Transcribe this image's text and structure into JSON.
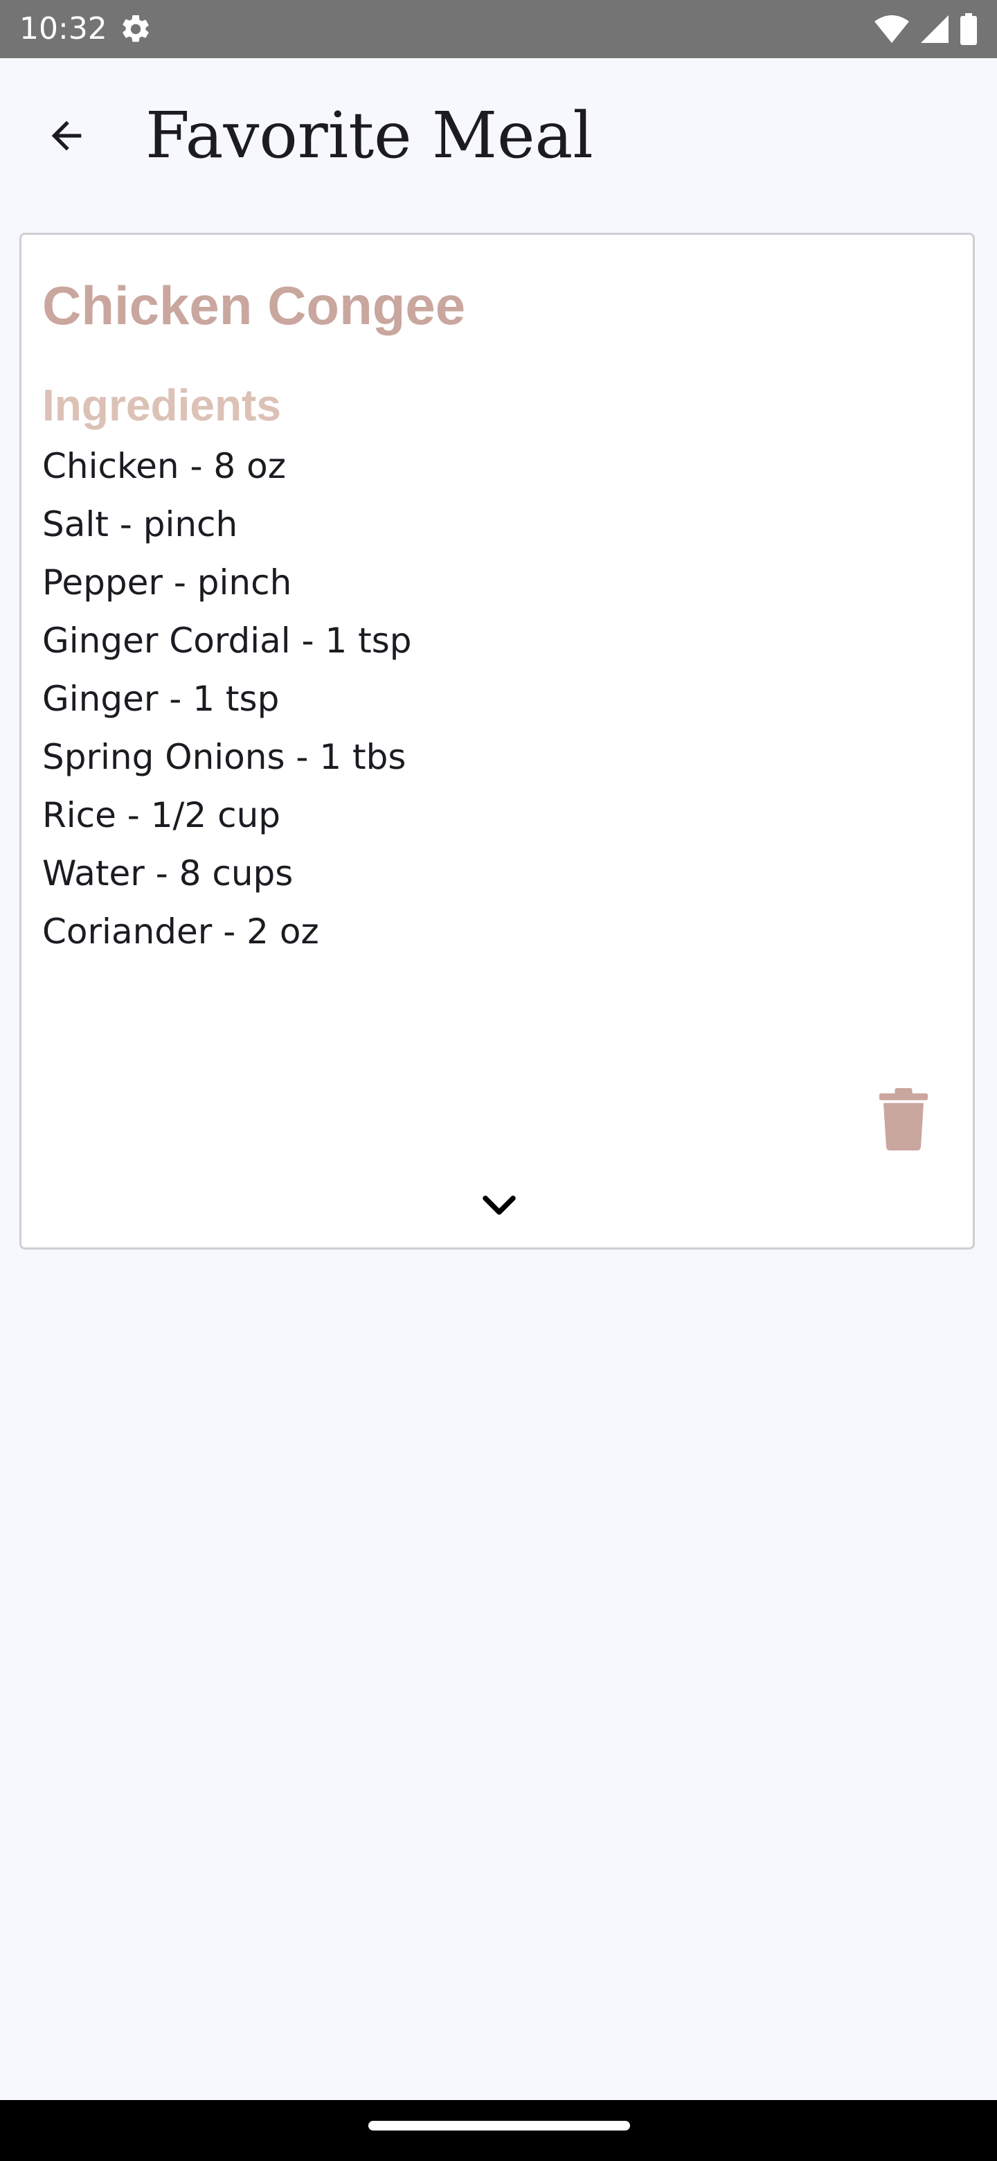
{
  "status_bar": {
    "time": "10:32",
    "icons": [
      "settings-gear-icon",
      "wifi-icon",
      "cellular-signal-icon",
      "battery-icon"
    ]
  },
  "app_bar": {
    "back_icon": "arrow-back-icon",
    "title": "Favorite Meal"
  },
  "meal_card": {
    "name": "Chicken Congee",
    "ingredients_heading": "Ingredients",
    "ingredients": [
      "Chicken - 8 oz",
      "Salt - pinch",
      "Pepper - pinch",
      "Ginger Cordial - 1 tsp",
      "Ginger - 1 tsp",
      "Spring Onions - 1 tbs",
      "Rice - 1/2 cup",
      "Water - 8 cups",
      "Coriander - 2 oz"
    ],
    "delete_icon": "trash-icon",
    "expand_icon": "chevron-down-icon"
  },
  "colors": {
    "background": "#f7f8fd",
    "status_bar": "#747474",
    "meal_name": "#c9a69e",
    "ingredients_heading": "#dcc1b6",
    "delete_icon": "#c9a69e",
    "text": "#1b1b21"
  }
}
